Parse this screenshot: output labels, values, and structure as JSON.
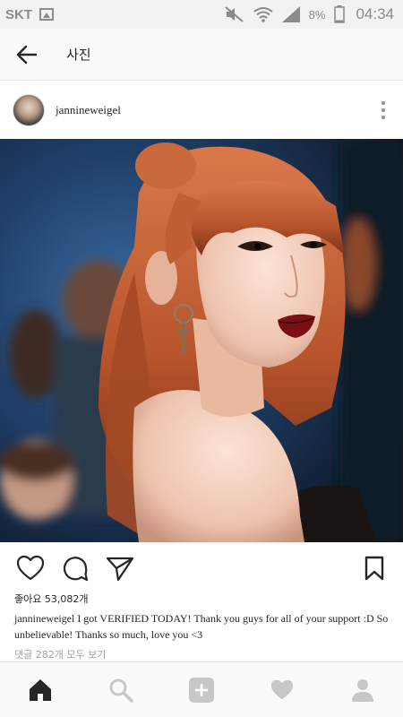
{
  "status_bar": {
    "carrier": "SKT",
    "battery": "8%",
    "time": "04:34",
    "icons": [
      "image-notification-icon",
      "mute-icon",
      "wifi-icon",
      "signal-icon",
      "battery-icon"
    ]
  },
  "header": {
    "title": "사진",
    "back_icon": "back-arrow-icon"
  },
  "post": {
    "username": "jannineweigel",
    "more_icon": "more-vertical-icon",
    "likes": "좋아요 53,082개",
    "caption_user": "jannineweigel",
    "caption_text": "I got VERIFIED TODAY! Thank you guys for all of your support :D So unbelievable! Thanks so much, love you <3",
    "view_comments": "댓글 282개 모두 보기"
  },
  "actions": {
    "icons": [
      "heart-icon",
      "comment-icon",
      "share-icon",
      "bookmark-icon"
    ]
  },
  "bottom_nav": {
    "icons": [
      "home-icon",
      "search-icon",
      "add-post-icon",
      "activity-heart-icon",
      "profile-icon"
    ]
  },
  "colors": {
    "text": "#262626",
    "muted": "#a0a0a0",
    "hair": "#c8643a",
    "lips": "#7a0f14",
    "background_blue": "#1f3f6a"
  }
}
